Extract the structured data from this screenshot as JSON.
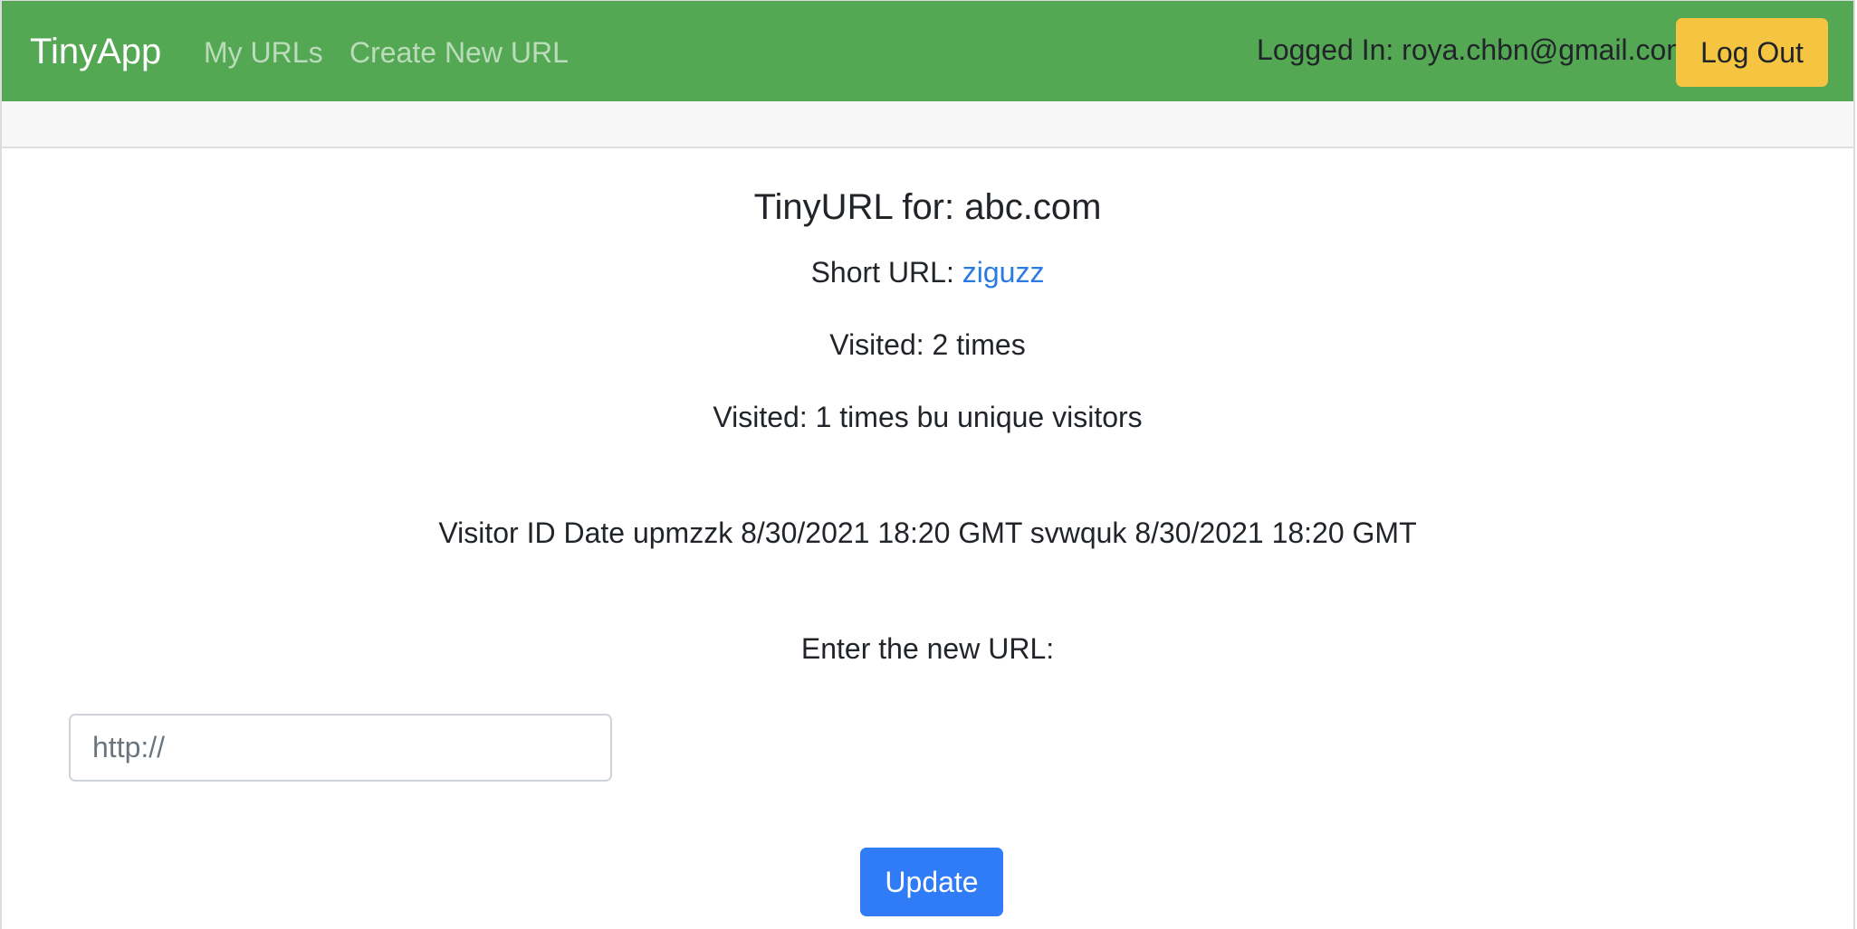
{
  "navbar": {
    "brand": "TinyApp",
    "links": [
      {
        "label": "My URLs"
      },
      {
        "label": "Create New URL"
      }
    ],
    "logged_in_label": "Logged In: ",
    "user_email": "roya.chbn@gmail.com",
    "logout_label": "Log Out",
    "colors": {
      "background": "#54a853",
      "logout_button": "#f5c542"
    }
  },
  "main": {
    "title": "TinyURL for: abc.com",
    "short_url_label": "Short URL: ",
    "short_url_value": "ziguzz",
    "visited_text": "Visited: 2 times",
    "unique_text": "Visited: 1 times bu unique visitors",
    "visitors_table": {
      "headers": [
        "Visitor ID",
        "Date"
      ],
      "rows": [
        [
          "upmzzk",
          "8/30/2021 18:20 GMT"
        ],
        [
          "svwquk",
          "8/30/2021 18:20 GMT"
        ]
      ]
    },
    "form": {
      "label": "Enter the new URL:",
      "input_placeholder": "http://",
      "input_value": "",
      "submit_label": "Update",
      "submit_color": "#2f7cf6"
    }
  }
}
